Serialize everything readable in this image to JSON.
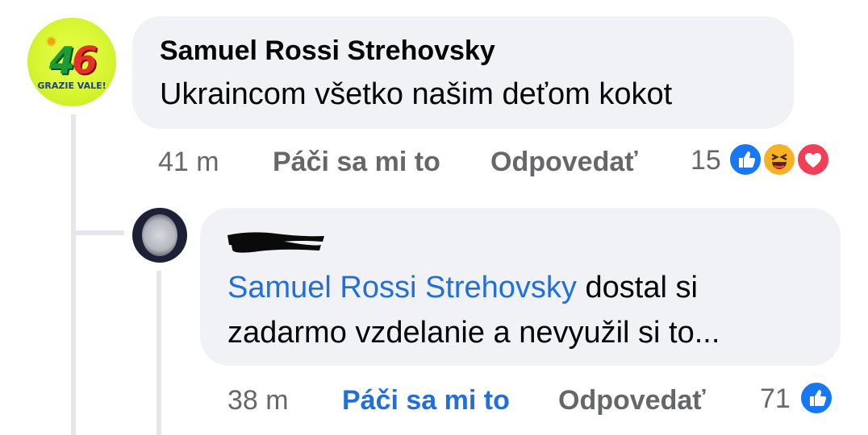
{
  "colors": {
    "bubble_bg": "#f0f2f5",
    "link_blue": "#216fdb",
    "meta_gray": "#65676b",
    "like_blue": "#1877f2",
    "haha_yellow": "#f7b125",
    "love_red": "#f33e58"
  },
  "comment": {
    "avatar": {
      "number": "46",
      "caption": "GRAZIE VALE!"
    },
    "author": "Samuel Rossi Strehovsky",
    "text": "Ukraincom všetko našim deťom kokot",
    "time": "41 m",
    "like_label": "Páči sa mi to",
    "reply_label": "Odpovedať",
    "reaction_count": "15",
    "reactions": [
      "like-icon",
      "haha-icon",
      "love-icon"
    ]
  },
  "reply": {
    "author_redacted": true,
    "mention": "Samuel Rossi Strehovsky",
    "text_line1_rest": " dostal si",
    "text_line2": "zadarmo vzdelanie a nevyužil si to...",
    "time": "38 m",
    "like_label": "Páči sa mi to",
    "like_active": true,
    "reply_label": "Odpovedať",
    "reaction_count": "71",
    "reactions": [
      "like-icon"
    ]
  }
}
